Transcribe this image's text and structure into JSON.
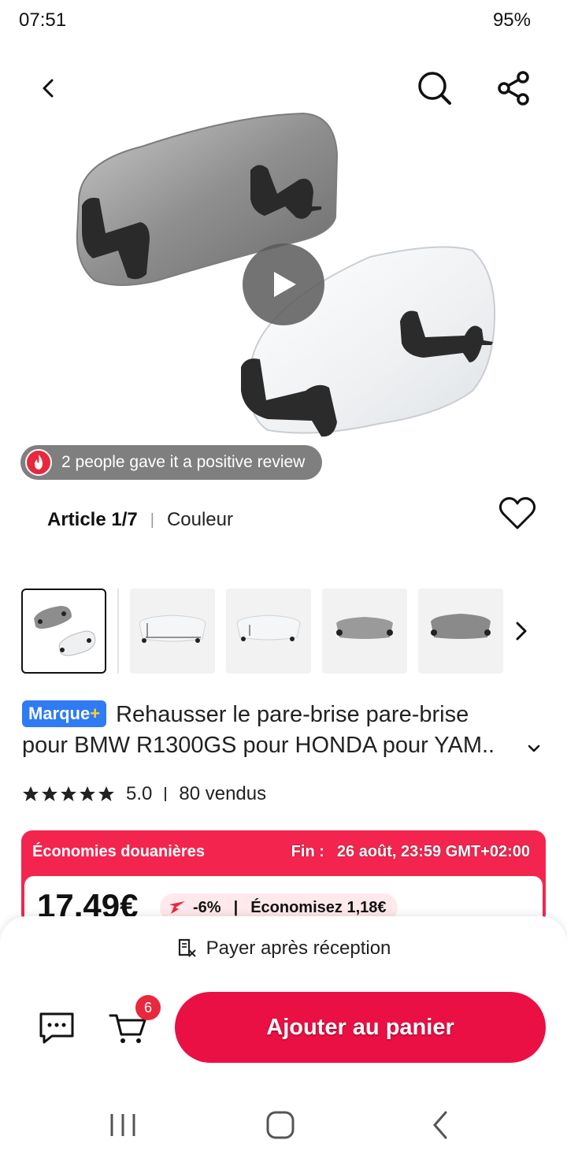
{
  "status_bar": {
    "time": "07:51",
    "battery": "95%"
  },
  "hero": {
    "review_text": "2 people gave it a positive review",
    "icons": [
      "back-arrow-icon",
      "search-icon",
      "share-icon",
      "play-icon",
      "fire-icon"
    ]
  },
  "variant": {
    "article": "Article 1/7",
    "option_name": "Couleur"
  },
  "product": {
    "badge": "Marque",
    "badge_plus": "+",
    "title_line1": "Rehausser le pare-brise pare-brise",
    "title_line2": "pour BMW R1300GS pour HONDA pour YAM..",
    "rating": "5.0",
    "sold": "80 vendus",
    "stars": 5
  },
  "promo": {
    "title": "Économies douanières",
    "ends_label": "Fin :",
    "ends_value": "26 août, 23:59 GMT+02:00",
    "price": "17,49€",
    "discount": "-6%",
    "savings": "Économisez 1,18€"
  },
  "bottom_bar": {
    "pay_after": "Payer après réception",
    "cart_count": "6",
    "add_to_cart": "Ajouter au panier"
  },
  "colors": {
    "accent": "#ea1044",
    "promo_bg": "#f3254f",
    "badge_blue": "#2e7bf4"
  }
}
